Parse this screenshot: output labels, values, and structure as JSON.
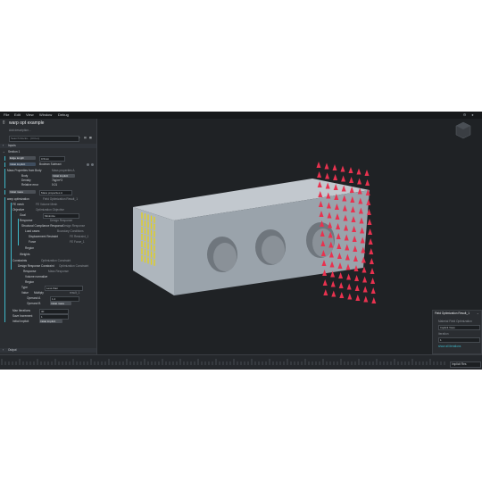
{
  "menu": [
    "File",
    "Edit",
    "View",
    "Window",
    "Debug"
  ],
  "panel": {
    "title": "warp opt example",
    "description_placeholder": "Add description...",
    "search_placeholder": "Search blocks... (Ctrl+L)",
    "inputs_label": "Inputs",
    "section_label": "Section 1",
    "edge_length_label": "Edge length",
    "edge_length_value": "0.5mm",
    "initial_implicit_label": "Initial Implicit",
    "initial_implicit_value": "Boolean Subtract",
    "mass_props_label": "Mass Properties from Body",
    "mass_props_value": "Mass properties A",
    "body_label": "Body",
    "body_value": "Initial Implicit",
    "density_label": "Density",
    "density_value": "7kg/m^3",
    "relative_error_label": "Relative error",
    "relative_error_value": "0.01",
    "initial_mass_label": "Initial mass",
    "initial_mass_value": "Mass properties A",
    "warp_opt_label": "warp optimization",
    "warp_opt_value": "Field Optimization Result_1",
    "fe_mesh_label": "FE mesh",
    "fe_mesh_value": "FE Volume Mesh",
    "objective_label": "Objective",
    "objective_value": "Optimization Objective",
    "goal_label": "Goal",
    "goal_value": "Minimize",
    "response_label": "Response",
    "response_value": "Design Response",
    "structural_label": "Structural Compliance Response",
    "structural_value": "Design Response",
    "load_cases_label": "Load cases",
    "load_cases_value": "Boundary Conditions",
    "displacement_label": "Displacement Restraint",
    "displacement_value": "FE Restraint_1",
    "force_label": "Force",
    "force_value": "FE Force_1",
    "region_label": "Region",
    "weights_label": "Weights",
    "constraints_label": "Constraints",
    "constraints_value": "Optimization Constraint",
    "design_resp_label": "Design Response Constraint",
    "design_resp_value": "Optimization Constraint",
    "response2_label": "Response",
    "response2_value": "Mass Response",
    "volume_norm_label": "Volume normalize",
    "region2_label": "Region",
    "type_label": "Type",
    "type_value": "Less than",
    "value_label": "Value",
    "value_value": "Multiply",
    "value_result": "result_1",
    "operand_a_label": "Operand A",
    "operand_a_value": "1.2",
    "operand_b_label": "Operand B",
    "operand_b_value": "Initial mass",
    "max_iter_label": "Max Iterations",
    "max_iter_value": "30",
    "save_inc_label": "Save Increment",
    "save_inc_value": "1",
    "initial_implicit2_label": "Initial Implicit",
    "initial_implicit2_value": "Initial Implicit",
    "output_label": "Output"
  },
  "viewport": {
    "view_cube_label": "TOP"
  },
  "right_card": {
    "title": "Field Optimization Result_1",
    "material_label": "Material Field Optimization",
    "view_label": "Implicit View",
    "iteration_label": "Iteration",
    "iteration_value": "1",
    "link_text": "show all iterations"
  },
  "timeline": {
    "select_value": "Implicit Res"
  },
  "colors": {
    "accent_cyan": "#3fb8c9",
    "force_yellow": "#e6d21a",
    "restraint_red": "#e8324f",
    "part_gray": "#9aa3ab"
  }
}
